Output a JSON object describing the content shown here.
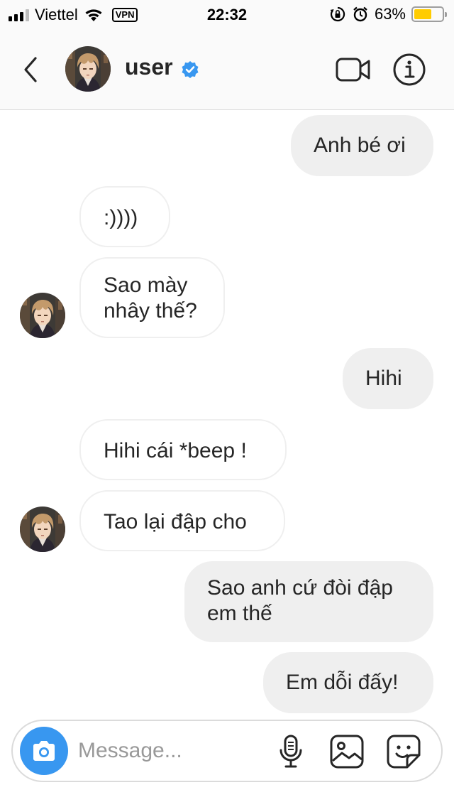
{
  "status_bar": {
    "carrier": "Viettel",
    "vpn": "VPN",
    "time": "22:32",
    "battery_percent": "63%",
    "battery_level": 0.63,
    "icons": [
      "signal-icon",
      "wifi-icon",
      "orientation-lock-icon",
      "alarm-icon",
      "battery-icon"
    ]
  },
  "header": {
    "username": "user",
    "verified": true,
    "icons": [
      "back-icon",
      "verified-badge-icon",
      "video-call-icon",
      "info-icon"
    ]
  },
  "messages": [
    {
      "side": "outgoing",
      "text": "Anh bé ơi"
    },
    {
      "side": "incoming",
      "text": ":))))"
    },
    {
      "side": "incoming",
      "text": "Sao mày nhây thế?"
    },
    {
      "side": "outgoing",
      "text": "Hihi"
    },
    {
      "side": "incoming",
      "text": "Hihi cái *beep !"
    },
    {
      "side": "incoming",
      "text": "Tao lại đập cho"
    },
    {
      "side": "outgoing",
      "text": "Sao anh cứ đòi đập em thế"
    },
    {
      "side": "outgoing",
      "text": "Em dỗi đấy!"
    }
  ],
  "composer": {
    "placeholder": "Message...",
    "value": "",
    "icons": [
      "camera-icon",
      "microphone-icon",
      "gallery-icon",
      "sticker-icon"
    ]
  },
  "colors": {
    "accent": "#3897f0",
    "outgoing_bubble": "#efefef",
    "battery": "#ffcc00"
  }
}
